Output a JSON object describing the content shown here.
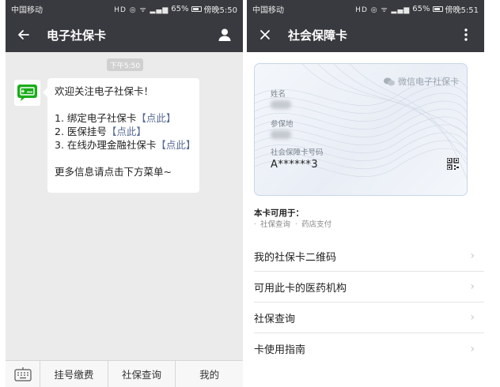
{
  "left": {
    "status": {
      "carrier": "中国移动",
      "icons": "HD ◎ ᯤ ▂▄▆",
      "battery": "65%",
      "time": "傍晚5:50"
    },
    "navbar": {
      "title": "电子社保卡",
      "back_icon": "back-arrow-icon",
      "profile_icon": "person-icon"
    },
    "chat": {
      "timestamp": "下午5:50",
      "greeting": "欢迎关注电子社保卡！",
      "items": [
        {
          "text": "1. 绑定电子社保卡",
          "link": "【点此】"
        },
        {
          "text": "2. 医保挂号",
          "link": "【点此】"
        },
        {
          "text": "3. 在线办理金融社保卡",
          "link": "【点此】"
        }
      ],
      "footer": "更多信息请点击下方菜单~"
    },
    "menu": {
      "items": [
        "挂号缴费",
        "社保查询",
        "我的"
      ]
    },
    "colors": {
      "bar": "#393a3f",
      "avatar_green": "#1aad19",
      "link": "#576b95"
    }
  },
  "right": {
    "status": {
      "carrier": "中国移动",
      "icons": "HD ◎ ᯤ ▂▄▆",
      "battery": "65%",
      "time": "傍晚5:51"
    },
    "navbar": {
      "title": "社会保障卡",
      "close_icon": "close-icon",
      "more_icon": "more-vertical-icon"
    },
    "card": {
      "brand": "微信电子社保卡",
      "name_label": "姓名",
      "place_label": "参保地",
      "number_label": "社会保障卡号码",
      "number": "A******3"
    },
    "usage": {
      "title": "本卡可用于：",
      "tags": [
        "社保查询",
        "药店支付"
      ]
    },
    "list": [
      "我的社保卡二维码",
      "可用此卡的医药机构",
      "社保查询",
      "卡使用指南"
    ]
  }
}
